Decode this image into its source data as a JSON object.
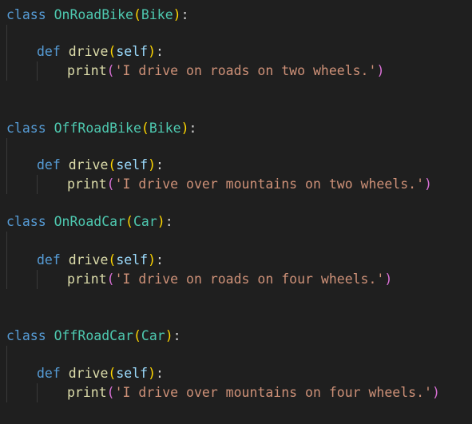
{
  "editor": {
    "lines": [
      {
        "kw": "class",
        "name": "OnRoadBike",
        "open": "(",
        "base": "Bike",
        "close": ")",
        "colon": ":"
      },
      {
        "kw": "def",
        "fn": "drive",
        "open": "(",
        "param": "self",
        "close": ")",
        "colon": ":"
      },
      {
        "fn": "print",
        "open": "(",
        "str": "'I drive on roads on two wheels.'",
        "close": ")"
      },
      {
        "kw": "class",
        "name": "OffRoadBike",
        "open": "(",
        "base": "Bike",
        "close": ")",
        "colon": ":"
      },
      {
        "kw": "def",
        "fn": "drive",
        "open": "(",
        "param": "self",
        "close": ")",
        "colon": ":"
      },
      {
        "fn": "print",
        "open": "(",
        "str": "'I drive over mountains on two wheels.'",
        "close": ")"
      },
      {
        "kw": "class",
        "name": "OnRoadCar",
        "open": "(",
        "base": "Car",
        "close": ")",
        "colon": ":"
      },
      {
        "kw": "def",
        "fn": "drive",
        "open": "(",
        "param": "self",
        "close": ")",
        "colon": ":"
      },
      {
        "fn": "print",
        "open": "(",
        "str": "'I drive on roads on four wheels.'",
        "close": ")"
      },
      {
        "kw": "class",
        "name": "OffRoadCar",
        "open": "(",
        "base": "Car",
        "close": ")",
        "colon": ":"
      },
      {
        "kw": "def",
        "fn": "drive",
        "open": "(",
        "param": "self",
        "close": ")",
        "colon": ":"
      },
      {
        "fn": "print",
        "open": "(",
        "str": "'I drive over mountains on four wheels.'",
        "close": ")"
      }
    ]
  },
  "colors": {
    "background": "#1f1f1f",
    "keyword": "#569cd6",
    "class_name": "#4ec9b0",
    "function": "#dcdcaa",
    "parameter": "#9cdcfe",
    "string": "#ce9178",
    "bracket_level_1": "#ffd700",
    "bracket_level_2": "#da70d6",
    "punctuation": "#d4d4d4",
    "indent_guide": "#3a3a3a"
  }
}
